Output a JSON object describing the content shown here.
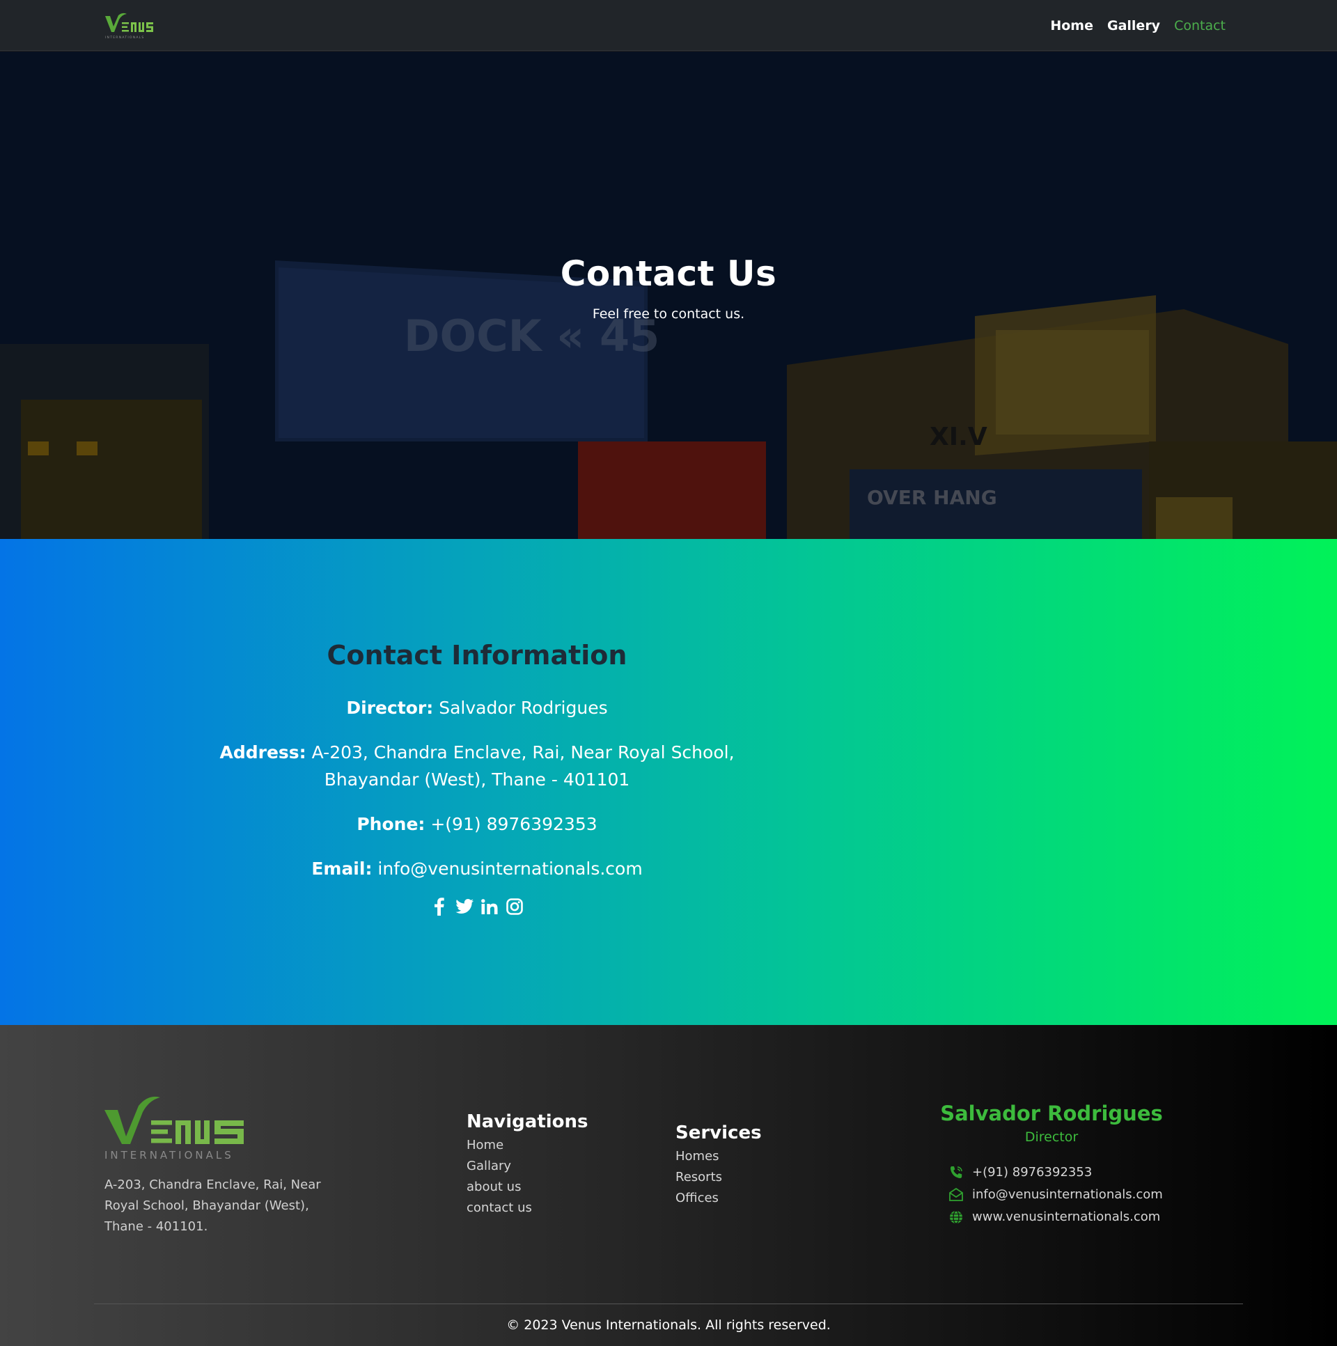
{
  "brand": {
    "logo_text": "VENUS",
    "logo_sub": "INTERNATIONALS",
    "green": "#4cae4c",
    "dark_green": "#3a8a2a"
  },
  "nav": {
    "items": [
      {
        "label": "Home"
      },
      {
        "label": "Gallery"
      },
      {
        "label": "Contact"
      }
    ]
  },
  "hero": {
    "title": "Contact Us",
    "subtitle": "Feel free to contact us."
  },
  "contact": {
    "title": "Contact Information",
    "director_label": "Director:",
    "director_value": "Salvador Rodrigues",
    "address_label": "Address:",
    "address_value": "A-203, Chandra Enclave, Rai, Near Royal School, Bhayandar (West), Thane - 401101",
    "phone_label": "Phone:",
    "phone_value": "+(91) 8976392353",
    "email_label": "Email:",
    "email_value": "info@venusinternationals.com",
    "socials": [
      "facebook-icon",
      "twitter-icon",
      "linkedin-icon",
      "instagram-icon"
    ]
  },
  "footer": {
    "address": "A-203, Chandra Enclave, Rai, Near Royal School, Bhayandar (West), Thane - 401101.",
    "nav_title": "Navigations",
    "nav_items": [
      "Home",
      "Gallary",
      "about us",
      "contact us"
    ],
    "services_title": "Services",
    "services_items": [
      "Homes",
      "Resorts",
      "Offices"
    ],
    "person_name": "Salvador Rodrigues",
    "person_role": "Director",
    "phone": "+(91) 8976392353",
    "email": "info@venusinternationals.com",
    "website": "www.venusinternationals.com",
    "copyright": "© 2023 Venus Internationals. All rights reserved."
  }
}
